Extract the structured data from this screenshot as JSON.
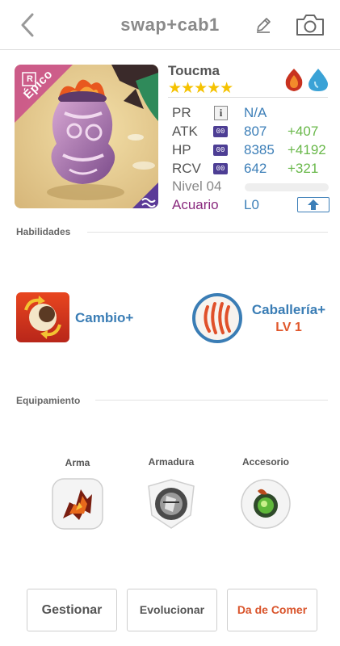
{
  "header": {
    "title": "swap+cab1",
    "back_icon": "chevron-left-icon",
    "edit_icon": "pencil-icon",
    "camera_icon": "camera-icon"
  },
  "monster": {
    "name": "Toucma",
    "stars": "★★★★★",
    "star_count": 5,
    "rarity_badge": "Épico",
    "rank_badge": "R",
    "elements": [
      "fire",
      "water"
    ],
    "stats": {
      "pr": {
        "label": "PR",
        "value": "N/A"
      },
      "atk": {
        "label": "ATK",
        "badge": "00",
        "value": "807",
        "bonus": "+407"
      },
      "hp": {
        "label": "HP",
        "badge": "00",
        "value": "8385",
        "bonus": "+4192"
      },
      "rcv": {
        "label": "RCV",
        "badge": "00",
        "value": "642",
        "bonus": "+321"
      },
      "level": {
        "label": "Nivel 04",
        "progress": 0
      },
      "habitat": {
        "label": "Acuario",
        "value": "L0"
      }
    }
  },
  "sections": {
    "skills_title": "Habilidades",
    "equipment_title": "Equipamiento"
  },
  "skills": [
    {
      "name": "Cambio+",
      "icon": "swap-skill-icon"
    },
    {
      "name": "Caballería+",
      "level": "LV 1",
      "icon": "cavalry-skill-icon"
    }
  ],
  "equipment": [
    {
      "label": "Arma",
      "icon": "weapon-icon"
    },
    {
      "label": "Armadura",
      "icon": "armor-icon"
    },
    {
      "label": "Accesorio",
      "icon": "accessory-icon"
    }
  ],
  "actions": {
    "manage": "Gestionar",
    "evolve": "Evolucionar",
    "feed": "Da de Comer"
  },
  "colors": {
    "accent_blue": "#3d7fb8",
    "bonus_green": "#69b84a",
    "feed_red": "#d9542b",
    "star_yellow": "#f5c200",
    "habitat_purple": "#8a2a7e"
  }
}
